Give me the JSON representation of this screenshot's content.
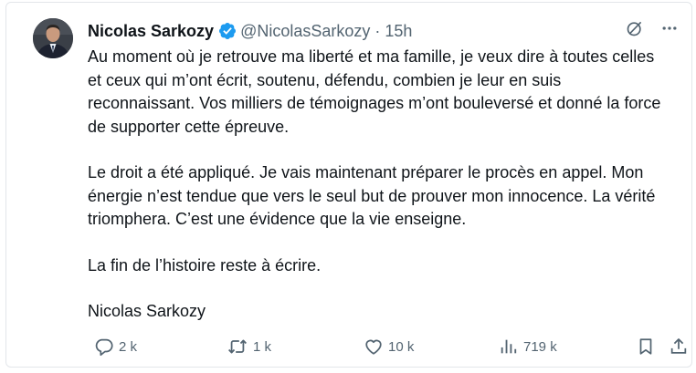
{
  "author": {
    "display_name": "Nicolas Sarkozy",
    "handle": "@NicolasSarkozy",
    "separator": "·",
    "time": "15h"
  },
  "body": {
    "paragraphs": [
      "Au moment où je retrouve ma liberté et ma famille, je veux dire à toutes celles et ceux qui m’ont écrit, soutenu, défendu, combien je leur en suis reconnaissant. Vos milliers de témoignages m’ont bouleversé et donné la force de supporter cette épreuve.",
      "Le droit a été appliqué. Je vais maintenant préparer le procès en appel. Mon énergie n’est tendue que vers le seul but de prouver mon innocence. La vérité triomphera. C’est une évidence que la vie enseigne.",
      "La fin de l’histoire reste à écrire.",
      "Nicolas Sarkozy"
    ]
  },
  "actions": {
    "replies": "2 k",
    "reposts": "1 k",
    "likes": "10 k",
    "views": "719 k"
  },
  "icons": {
    "verified": "verified-badge-icon",
    "grok": "grok-icon",
    "more": "more-icon",
    "reply": "reply-icon",
    "repost": "repost-icon",
    "like": "like-icon",
    "views": "views-icon",
    "bookmark": "bookmark-icon",
    "share": "share-icon"
  },
  "colors": {
    "text": "#0f1419",
    "secondary": "#536471",
    "verified": "#1d9bf0",
    "border": "#e3e6ea"
  }
}
